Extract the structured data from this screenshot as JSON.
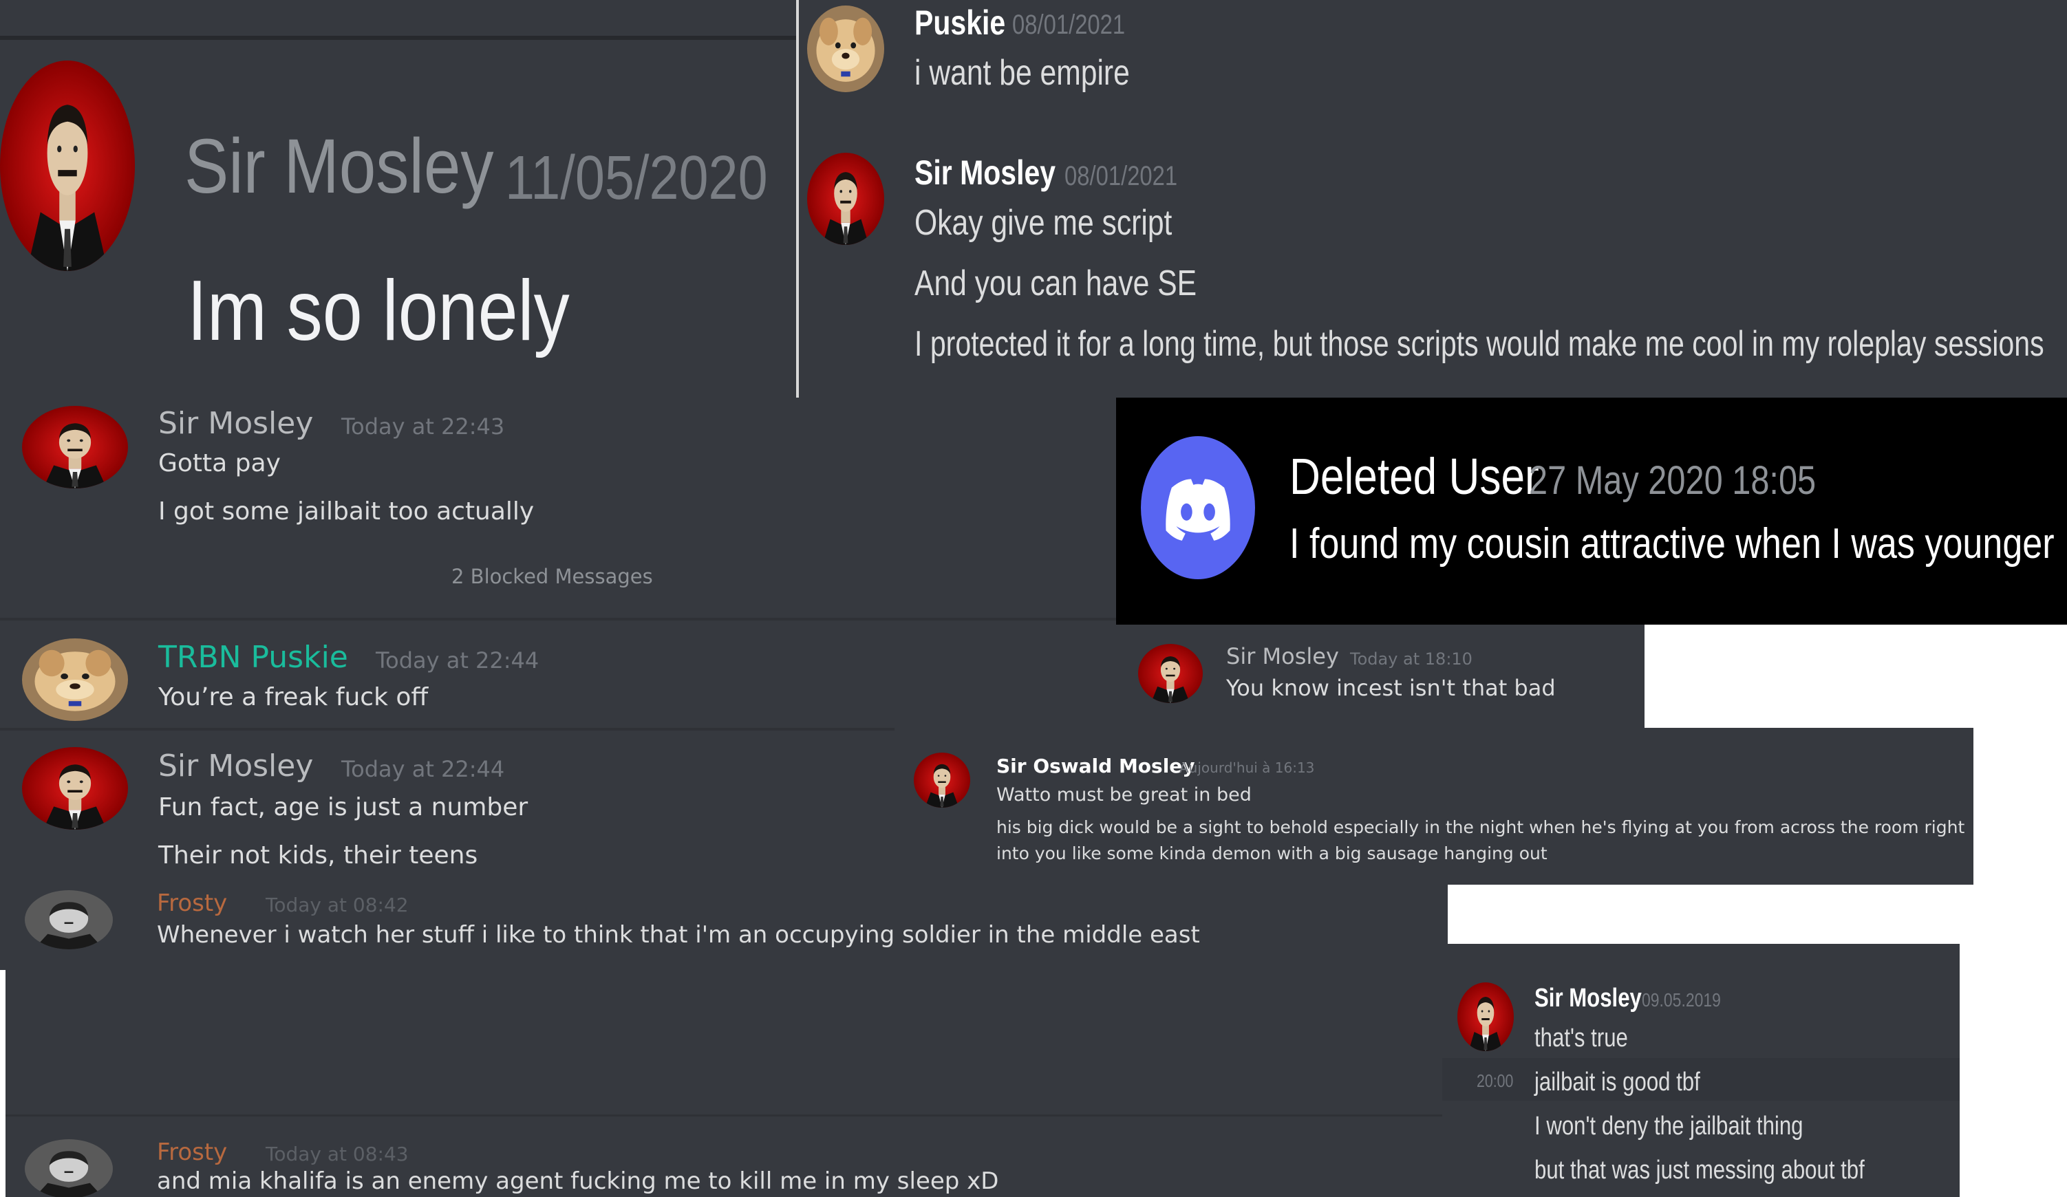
{
  "colors": {
    "discord_bg": "#36393f",
    "dark_bg": "#2f3136",
    "black_bg": "#000000",
    "blurple": "#5865f2",
    "teal_name": "#1abc9c",
    "orange_name": "#b8693f",
    "username_gray": "#b9bbbe",
    "message_text": "#dcddde"
  },
  "p1": {
    "name": "Sir Mosley",
    "time": "11/05/2020",
    "msg": "Im so lonely",
    "avatar": "mosley-avatar"
  },
  "p2": {
    "m1": {
      "name": "Puskie",
      "time": "08/01/2021",
      "msg": "i want be empire",
      "avatar": "dog-avatar"
    },
    "m2": {
      "name": "Sir Mosley",
      "time": "08/01/2021",
      "lines": [
        "Okay give me script",
        "And you can have SE",
        "I protected it for a long time, but those scripts would make me cool in my roleplay sessions"
      ],
      "avatar": "mosley-avatar"
    }
  },
  "p3": {
    "m1": {
      "name": "Sir Mosley",
      "time": "Today at 22:43",
      "lines": [
        "Gotta pay",
        "I got some jailbait too actually"
      ]
    },
    "blocked": "2 Blocked Messages",
    "m2": {
      "name": "TRBN Puskie",
      "time": "Today at 22:44",
      "msg": "You’re a freak fuck off"
    },
    "m3": {
      "name": "Sir Mosley",
      "time": "Today at 22:44",
      "lines": [
        "Fun fact, age is just a number",
        "Their not kids, their teens"
      ]
    }
  },
  "p4": {
    "name": "Deleted User",
    "time": "27 May 2020 18:05",
    "msg": "I found my cousin attractive when I was younger",
    "avatar": "discord-logo"
  },
  "p5": {
    "name": "Sir Mosley",
    "time": "Today at 18:10",
    "msg": "You know incest isn't that bad"
  },
  "p6": {
    "name": "Sir Oswald Mosley",
    "time": "Aujourd'hui à 16:13",
    "lines": [
      "Watto must be great in bed",
      "his big dick would be a sight to behold especially in the night when he's flying at you from across the room right",
      "into you like some kinda demon with a big sausage hanging out"
    ]
  },
  "p7": {
    "name": "Frosty",
    "time": "Today at 08:42",
    "msg": "Whenever i watch her stuff i like to think that i'm an occupying soldier in the middle east"
  },
  "p8": {
    "name": "Frosty",
    "time": "Today at 08:43",
    "msg": "and mia khalifa is an enemy agent fucking me to kill me in  my sleep xD"
  },
  "p9": {
    "name": "Sir Mosley",
    "time": "09.05.2019",
    "hover_time": "20:00",
    "lines": [
      "that's true",
      "jailbait is good tbf",
      "I won't deny the jailbait thing",
      "but that was just messing about tbf"
    ]
  }
}
